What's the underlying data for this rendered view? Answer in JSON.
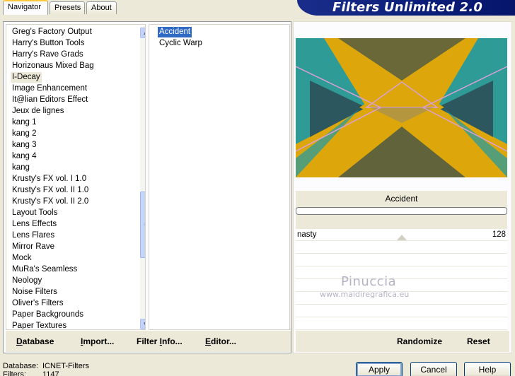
{
  "window": {
    "title": "Filters Unlimited 2.0"
  },
  "tabs": [
    {
      "label": "Navigator",
      "active": true
    },
    {
      "label": "Presets",
      "active": false
    },
    {
      "label": "About",
      "active": false
    }
  ],
  "categories": {
    "selected": "I-Decay",
    "items": [
      "Greg's Factory Output",
      "Harry's Button Tools",
      "Harry's Rave Grads",
      "Horizonaus Mixed Bag",
      "I-Decay",
      "Image Enhancement",
      "It@lian Editors Effect",
      "Jeux de lignes",
      "kang 1",
      "kang 2",
      "kang 3",
      "kang 4",
      "kang",
      "Krusty's FX vol. I 1.0",
      "Krusty's FX vol. II 1.0",
      "Krusty's FX vol. II 2.0",
      "Layout Tools",
      "Lens Effects",
      "Lens Flares",
      "Mirror Rave",
      "Mock",
      "MuRa's Seamless",
      "Neology",
      "Noise Filters",
      "Oliver's Filters",
      "Paper Backgrounds",
      "Paper Textures"
    ]
  },
  "filters": {
    "selected": "Accident",
    "items": [
      "Accident",
      "Cyclic Warp"
    ]
  },
  "left_buttons": {
    "database": "Database",
    "import": "Import...",
    "filter_info": "Filter Info...",
    "editor": "Editor..."
  },
  "preview": {
    "filter_name": "Accident",
    "progress": 0,
    "colors": {
      "base": "#dda70c",
      "teal": "#1b9aa6",
      "dark": "#2c4650",
      "pink": "#d9a0d6"
    }
  },
  "parameters": [
    {
      "name": "nasty",
      "value": "128"
    }
  ],
  "watermark": {
    "name": "Pinuccia",
    "url": "www.maidiregrafica.eu"
  },
  "right_buttons": {
    "randomize": "Randomize",
    "reset": "Reset"
  },
  "status": {
    "database_label": "Database:",
    "database_value": "ICNET-Filters",
    "filters_label": "Filters:",
    "filters_value": "1147"
  },
  "dialog_buttons": {
    "apply": "Apply",
    "cancel": "Cancel",
    "help": "Help"
  }
}
